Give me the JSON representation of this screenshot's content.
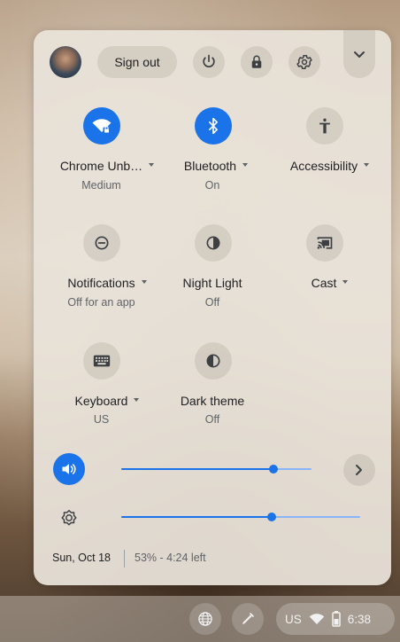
{
  "header": {
    "sign_out_label": "Sign out"
  },
  "tiles": [
    {
      "label": "Chrome Unb…",
      "sub": "Medium",
      "icon": "wifi-locked-icon",
      "on": true,
      "has_menu": true
    },
    {
      "label": "Bluetooth",
      "sub": "On",
      "icon": "bluetooth-icon",
      "on": true,
      "has_menu": true
    },
    {
      "label": "Accessibility",
      "sub": "",
      "icon": "accessibility-icon",
      "on": false,
      "has_menu": true
    },
    {
      "label": "Notifications",
      "sub": "Off for an app",
      "icon": "notifications-icon",
      "on": false,
      "has_menu": true
    },
    {
      "label": "Night Light",
      "sub": "Off",
      "icon": "night-light-icon",
      "on": false,
      "has_menu": false
    },
    {
      "label": "Cast",
      "sub": "",
      "icon": "cast-icon",
      "on": false,
      "has_menu": true
    },
    {
      "label": "Keyboard",
      "sub": "US",
      "icon": "keyboard-icon",
      "on": false,
      "has_menu": true
    },
    {
      "label": "Dark theme",
      "sub": "Off",
      "icon": "dark-theme-icon",
      "on": false,
      "has_menu": false
    }
  ],
  "sliders": {
    "volume_level": 0.8,
    "brightness_level": 0.63
  },
  "footer": {
    "date": "Sun, Oct 18",
    "battery": "53% - 4:24 left"
  },
  "shelf": {
    "ime": "US",
    "time": "6:38"
  },
  "colors": {
    "accent": "#1a73e8"
  }
}
